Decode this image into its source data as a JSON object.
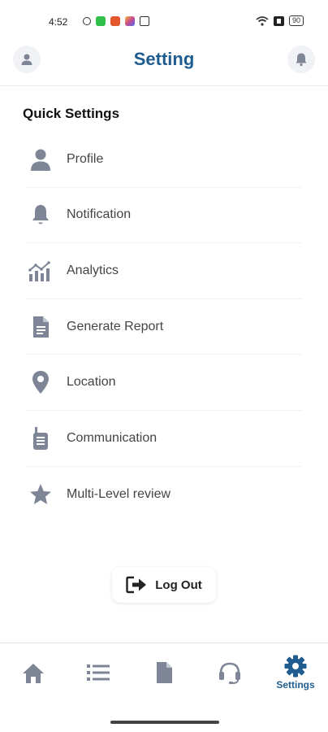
{
  "status_bar": {
    "time": "4:52",
    "battery": "90"
  },
  "header": {
    "title": "Setting",
    "left_icon": "user-icon",
    "right_icon": "bell-icon"
  },
  "quick_settings": {
    "title": "Quick Settings",
    "items": [
      {
        "label": "Profile",
        "icon": "user-icon"
      },
      {
        "label": "Notification",
        "icon": "bell-icon"
      },
      {
        "label": "Analytics",
        "icon": "analytics-icon"
      },
      {
        "label": "Generate Report",
        "icon": "document-icon"
      },
      {
        "label": "Location",
        "icon": "location-pin-icon"
      },
      {
        "label": "Communication",
        "icon": "walkie-talkie-icon"
      },
      {
        "label": "Multi-Level review",
        "icon": "star-icon"
      }
    ]
  },
  "logout": {
    "label": "Log Out",
    "icon": "logout-icon"
  },
  "bottom_nav": {
    "items": [
      {
        "icon": "home-icon"
      },
      {
        "icon": "list-icon"
      },
      {
        "icon": "document-icon"
      },
      {
        "icon": "headset-icon"
      },
      {
        "icon": "gear-icon",
        "label": "Settings",
        "active": true
      }
    ]
  },
  "colors": {
    "accent": "#1f5d91",
    "icon_gray": "#7d8596"
  }
}
